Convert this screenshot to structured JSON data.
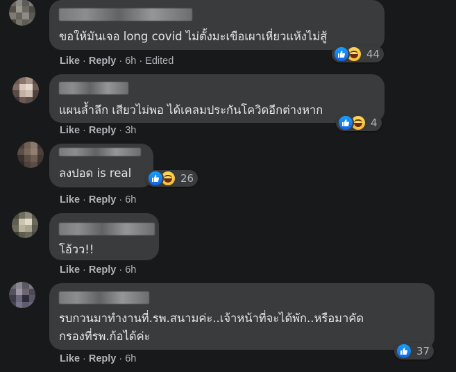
{
  "comments": [
    {
      "text": "ขอให้มันเจอ long covid ไม่ตั้งมะเขือเผาเหี่ยวแห้งไม่สู้",
      "actions": {
        "like": "Like",
        "reply": "Reply",
        "time": "6h",
        "edited": "Edited"
      },
      "reactions": {
        "types": [
          "like-icon",
          "haha-icon"
        ],
        "count": "44"
      },
      "avatar_colors": [
        "#6e6a62",
        "#8a8a84",
        "#5d5b57",
        "#7b7c77",
        "#545049",
        "#9a978e",
        "#6b6861",
        "#4d4a45",
        "#7e7b72",
        "#66635c",
        "#8d8b83",
        "#5a5852",
        "#4a4640",
        "#77746c",
        "#5f5c55",
        "#6a675f"
      ]
    },
    {
      "text": "แผนล้ำลึก เสียวไม่พอ ได้เคลมประกันโควิดอีกต่างหาก",
      "actions": {
        "like": "Like",
        "reply": "Reply",
        "time": "3h"
      },
      "reactions": {
        "types": [
          "like-icon",
          "haha-icon"
        ],
        "count": "4"
      },
      "avatar_colors": [
        "#6a5a52",
        "#8b746a",
        "#a89488",
        "#5b4c45",
        "#7e6c63",
        "#d8c8bd",
        "#e8d9ce",
        "#6d5d55",
        "#5a4b45",
        "#c2b0a5",
        "#d0bfb3",
        "#4f433d",
        "#3f3532",
        "#6a5a52",
        "#5c4e48",
        "#463b36"
      ]
    },
    {
      "text": "ลงปอด is real",
      "actions": {
        "like": "Like",
        "reply": "Reply",
        "time": "6h"
      },
      "reactions": {
        "types": [
          "like-icon",
          "haha-icon"
        ],
        "count": "26"
      },
      "avatar_colors": [
        "#4a3f38",
        "#6f5f54",
        "#8a7a6e",
        "#3e3530",
        "#5c4e46",
        "#7a675b",
        "#927f72",
        "#4c413b",
        "#3a322d",
        "#5a4c44",
        "#6e5d52",
        "#403731",
        "#2f2824",
        "#4d423b",
        "#5b4d45",
        "#37302b"
      ]
    },
    {
      "text": "โอ้วว!!",
      "actions": {
        "like": "Like",
        "reply": "Reply",
        "time": "6h"
      },
      "reactions": null,
      "avatar_colors": [
        "#4a4a3e",
        "#6e6d5f",
        "#8b8a7a",
        "#55544a",
        "#5f5e50",
        "#c9c3b0",
        "#e0dac6",
        "#6a6858",
        "#6d6a5a",
        "#b7b19e",
        "#a8a290",
        "#5b5a4c",
        "#3e3d34",
        "#5d5c4f",
        "#6a6959",
        "#4b4a40"
      ]
    },
    {
      "text": "รบกวนมาทำงานที่.รพ.สนามค่ะ..เจ้าหน้าที่จะได้พัก..หรือมาคัด\nกรองที่รพ.ก้อได้ค่ะ",
      "actions": {
        "like": "Like",
        "reply": "Reply",
        "time": "6h"
      },
      "reactions": {
        "types": [
          "like-icon"
        ],
        "count": "37"
      },
      "avatar_colors": [
        "#6e6a72",
        "#8a8690",
        "#5b5862",
        "#7c7884",
        "#555260",
        "#9a96a2",
        "#6a6672",
        "#4d4a56",
        "#3e3b48",
        "#6a667a",
        "#2e2b3a",
        "#5a5668",
        "#4a4756",
        "#77738a",
        "#5f5b70",
        "#6a6678"
      ]
    }
  ]
}
